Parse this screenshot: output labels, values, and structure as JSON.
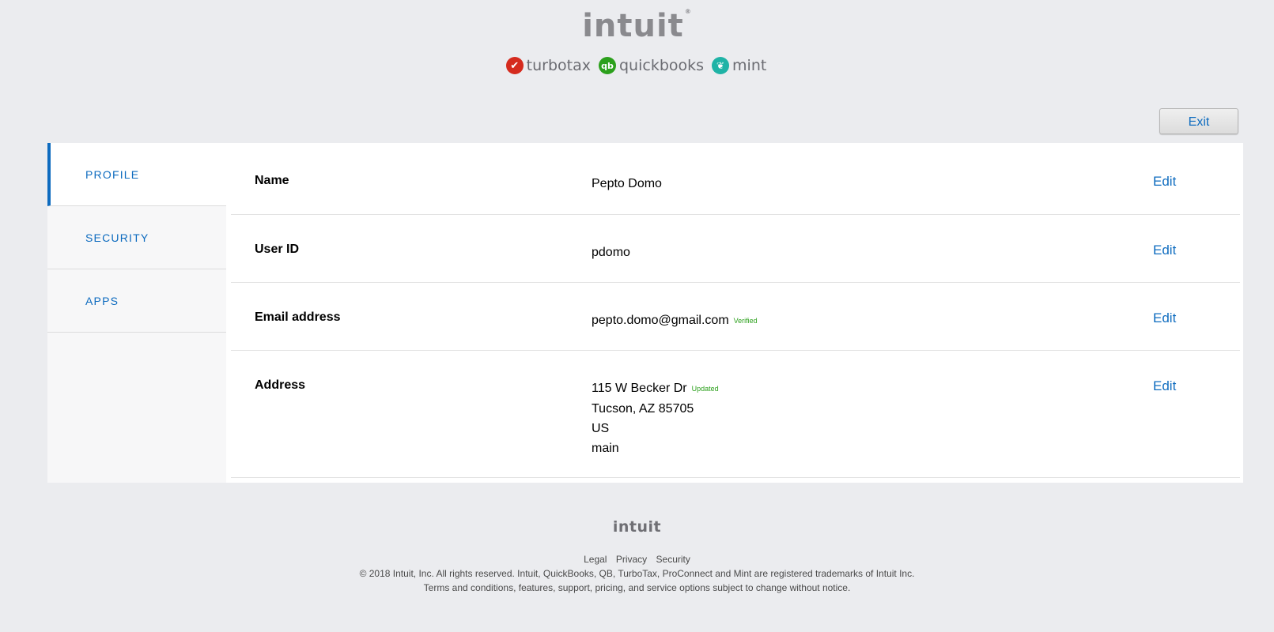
{
  "header": {
    "logo_text": "intuit",
    "logo_reg": "®",
    "brands": [
      {
        "name": "turbotax",
        "icon": "check-icon",
        "glyph": "✔",
        "color": "#d52b1e"
      },
      {
        "name": "quickbooks",
        "icon": "qb-icon",
        "glyph": "qb",
        "color": "#2ca01c"
      },
      {
        "name": "mint",
        "icon": "leaf-icon",
        "glyph": "❦",
        "color": "#1fb3a6"
      }
    ]
  },
  "exit_label": "Exit",
  "sidebar": {
    "items": [
      {
        "label": "PROFILE",
        "active": true
      },
      {
        "label": "SECURITY",
        "active": false
      },
      {
        "label": "APPS",
        "active": false
      }
    ]
  },
  "profile": {
    "edit_label": "Edit",
    "rows": [
      {
        "label": "Name",
        "value": "Pepto Domo"
      },
      {
        "label": "User ID",
        "value": "pdomo"
      },
      {
        "label": "Email address",
        "value": "pepto.domo@gmail.com",
        "badge": "Verified"
      },
      {
        "label": "Address",
        "lines": [
          "115 W Becker Dr",
          "Tucson, AZ 85705",
          "US",
          "main"
        ],
        "badge": "Updated"
      }
    ]
  },
  "footer": {
    "logo_text": "intuit",
    "links": [
      "Legal",
      "Privacy",
      "Security"
    ],
    "copyright": "© 2018 Intuit, Inc. All rights reserved. Intuit, QuickBooks, QB, TurboTax, ProConnect and Mint are registered trademarks of Intuit Inc.",
    "terms": "Terms and conditions, features, support, pricing, and service options subject to change without notice."
  },
  "colors": {
    "accent": "#0d6bbf",
    "badge_green": "#2ca01c",
    "background": "#ebecef"
  }
}
